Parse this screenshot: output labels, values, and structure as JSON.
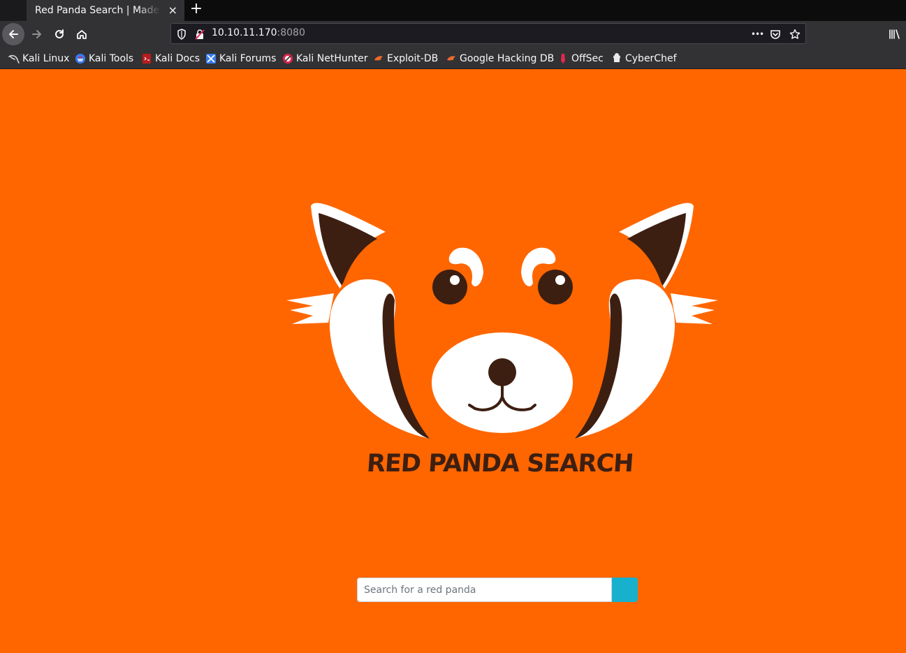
{
  "browser": {
    "tab_title": "Red Panda Search | Made with Spring Boot",
    "tab_close": "×",
    "new_tab": "+",
    "url_host": "10.10.11.170",
    "url_port": ":8080",
    "url_more": "•••"
  },
  "bookmarks": [
    {
      "label": "Kali Linux",
      "icon": "kali-dragon-icon"
    },
    {
      "label": "Kali Tools",
      "icon": "kali-tools-icon"
    },
    {
      "label": "Kali Docs",
      "icon": "kali-docs-icon"
    },
    {
      "label": "Kali Forums",
      "icon": "kali-forums-icon"
    },
    {
      "label": "Kali NetHunter",
      "icon": "nethunter-icon"
    },
    {
      "label": "Exploit-DB",
      "icon": "exploit-db-icon"
    },
    {
      "label": "Google Hacking DB",
      "icon": "ghdb-icon"
    },
    {
      "label": "OffSec",
      "icon": "offsec-icon"
    },
    {
      "label": "CyberChef",
      "icon": "cyberchef-icon"
    }
  ],
  "page": {
    "brand": "RED PANDA SEARCH",
    "search_placeholder": "Search for a red panda"
  },
  "colors": {
    "background": "#ff6600",
    "panda_dark": "#3d1f12",
    "search_button": "#17b1cd"
  }
}
